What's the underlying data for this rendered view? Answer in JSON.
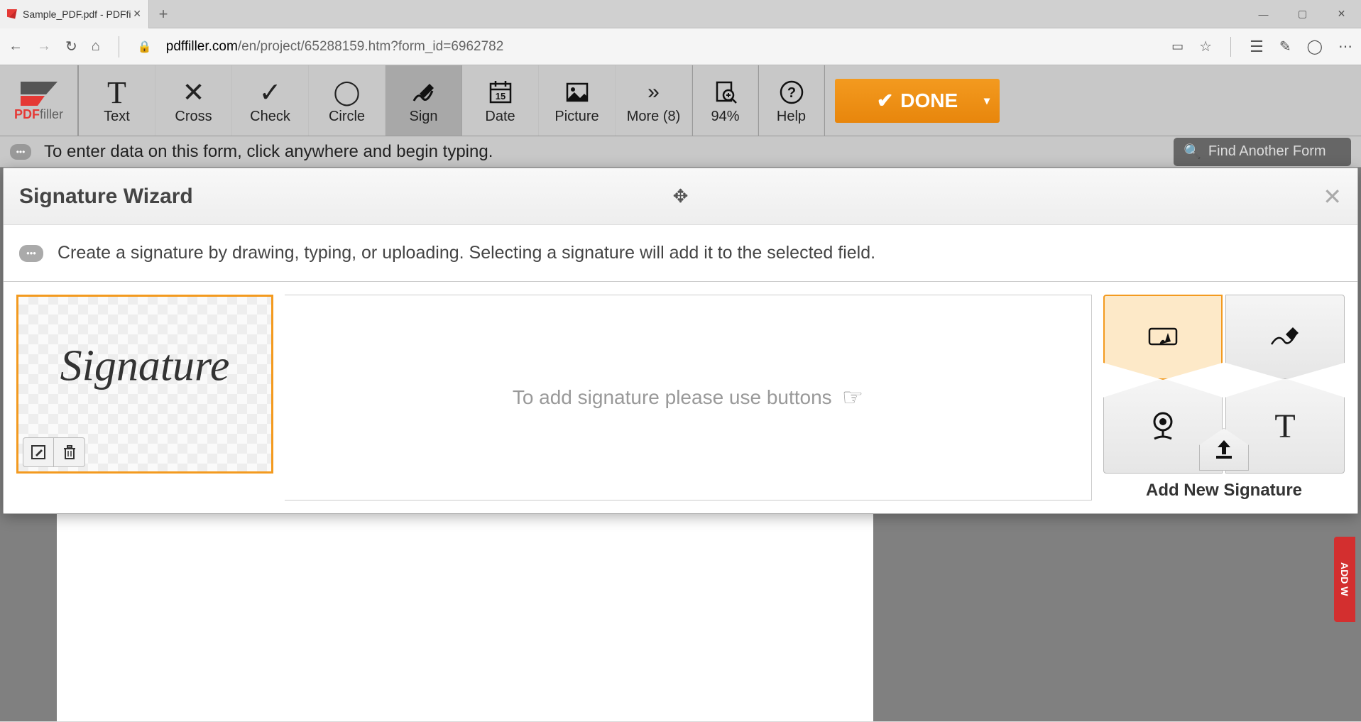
{
  "browser": {
    "tab_title": "Sample_PDF.pdf - PDFfi",
    "url_domain": "pdffiller.com",
    "url_path": "/en/project/65288159.htm?form_id=6962782"
  },
  "app": {
    "logo_pdf": "PDF",
    "logo_filler": "filler",
    "tools": {
      "text": "Text",
      "cross": "Cross",
      "check": "Check",
      "circle": "Circle",
      "sign": "Sign",
      "date": "Date",
      "picture": "Picture",
      "more": "More (8)"
    },
    "zoom": "94%",
    "help": "Help",
    "done": "DONE",
    "instruction": "To enter data on this form, click anywhere and begin typing.",
    "find_form": "Find Another Form"
  },
  "wizard": {
    "title": "Signature Wizard",
    "instruction": "Create a signature by drawing, typing, or uploading. Selecting a signature will add it to the selected field.",
    "preview_text": "Signature",
    "placeholder": "To add signature please use buttons",
    "add_label": "Add New Signature"
  },
  "sidebar": {
    "addw": "ADD W"
  }
}
